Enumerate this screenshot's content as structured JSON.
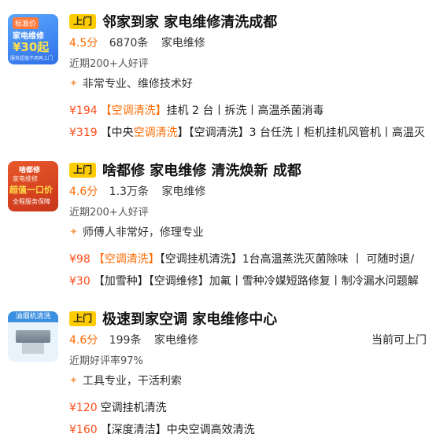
{
  "colors": {
    "badge": "#ffcc00",
    "accent": "#ff6a00",
    "price": "#ff4d1a"
  },
  "listings": [
    {
      "badge": "上门",
      "title": "邻家到家 家电维修清洗成都",
      "score": "4.5分",
      "count": "6870条",
      "category": "家电维修",
      "status": "",
      "review": "近期200+人好评",
      "highlight": "非常专业、维修技术好",
      "thumb": {
        "top": "标准价",
        "mid": "家电维修",
        "big": "¥30起",
        "bottom": "服务超值不用再上门"
      },
      "offers": [
        {
          "price": "¥194",
          "pre": "",
          "accent": "【空调清洗】",
          "rest": "挂机 2 台丨拆洗丨高温杀菌消毒"
        },
        {
          "price": "¥319",
          "pre": "【中央",
          "accent": "空调清洗",
          "rest": "】【空调清洗】3 台任洗丨柜机挂机风管机丨高温灭"
        }
      ]
    },
    {
      "badge": "上门",
      "title": "啥都修 家电维修 清洗焕新 成都",
      "score": "4.6分",
      "count": "1.3万条",
      "category": "家电维修",
      "status": "",
      "review": "近期200+人好评",
      "highlight": "师傅人非常好，修理专业",
      "thumb": {
        "top": "啥都修",
        "mid": "家电维修",
        "big": "超值一口价",
        "bottom": "全程服务保障"
      },
      "offers": [
        {
          "price": "¥98",
          "pre": "",
          "accent": "【空调清洗】",
          "rest": "【空调挂机清洗】1台高温蒸洗灭菌除味 丨 可随时退/"
        },
        {
          "price": "¥30",
          "pre": "",
          "accent": "",
          "rest": "【加雪种】【空调维修】加氟丨雪种冷媒短路修复丨制冷漏水问题解"
        }
      ]
    },
    {
      "badge": "上门",
      "title": "极速到家空调 家电维修中心",
      "score": "4.6分",
      "count": "199条",
      "category": "家电维修",
      "status": "当前可上门",
      "review": "近期好评率97%",
      "highlight": "工具专业，干活利索",
      "thumb": {
        "top": "油烟机清洗",
        "mid": "",
        "big": "",
        "bottom": ""
      },
      "offers": [
        {
          "price": "¥120",
          "pre": "",
          "accent": "",
          "rest": "空调挂机清洗"
        },
        {
          "price": "¥160",
          "pre": "",
          "accent": "",
          "rest": "【深度清洁】中央空调高效清洗"
        }
      ]
    }
  ]
}
